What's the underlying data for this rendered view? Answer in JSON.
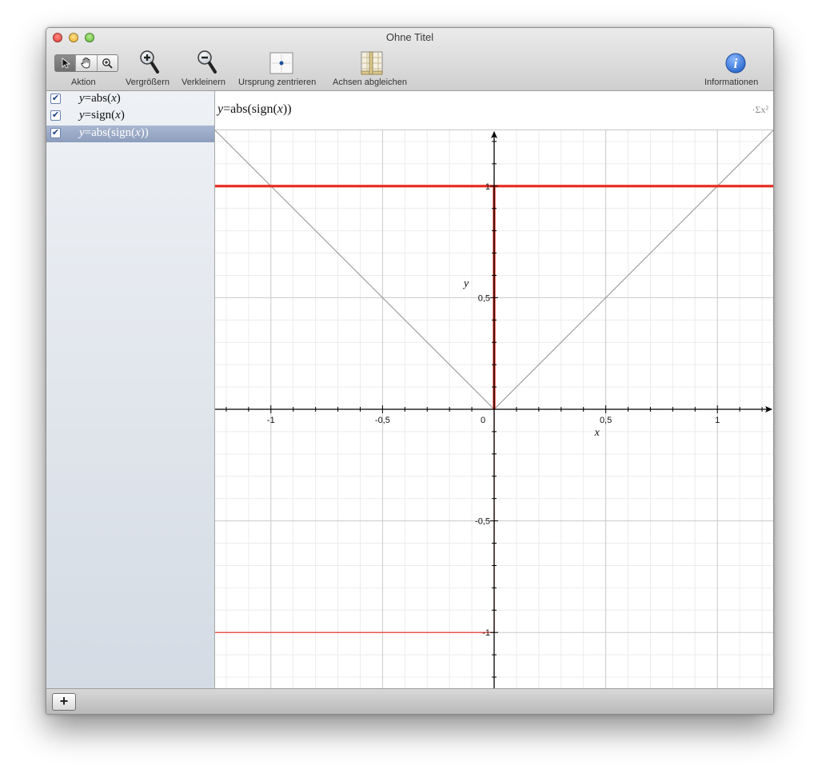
{
  "window": {
    "title": "Ohne Titel"
  },
  "toolbar": {
    "aktion": "Aktion",
    "zoom_in": "Vergrößern",
    "zoom_out": "Verkleinern",
    "center_origin": "Ursprung zentrieren",
    "align_axes": "Achsen abgleichen",
    "info": "Informationen"
  },
  "sidebar": {
    "items": [
      {
        "label": "y=abs(x)",
        "checked": true
      },
      {
        "label": "y=sign(x)",
        "checked": true
      },
      {
        "label": "y=abs(sign(x))",
        "checked": true,
        "selected": true
      }
    ]
  },
  "editor": {
    "expression": "y=abs(sign(x))",
    "sigma": "·Σx²"
  },
  "chart_data": {
    "type": "line",
    "xlabel": "x",
    "ylabel": "y",
    "xlim": [
      -1.25,
      1.25
    ],
    "ylim": [
      -1.25,
      1.25
    ],
    "x_ticks": [
      "-1",
      "-0,5",
      "0",
      "0,5",
      "1"
    ],
    "y_ticks": [
      "1",
      "0,5",
      "-0,5",
      "-1"
    ],
    "grid": true,
    "series": [
      {
        "name": "y=abs(x)",
        "color": "#a0a0a0",
        "x": [
          -1.25,
          0,
          1.25
        ],
        "y": [
          1.25,
          0,
          1.25
        ]
      },
      {
        "name": "y=sign(x)",
        "color": "#e7281d",
        "x": [
          -1.25,
          0,
          0,
          0,
          1.25
        ],
        "y": [
          -1,
          -1,
          0,
          1,
          1
        ]
      },
      {
        "name": "y=abs(sign(x))",
        "color": "#e7281d",
        "x": [
          -1.25,
          0,
          0,
          0,
          1.25
        ],
        "y": [
          1,
          1,
          0,
          1,
          1
        ]
      }
    ]
  }
}
